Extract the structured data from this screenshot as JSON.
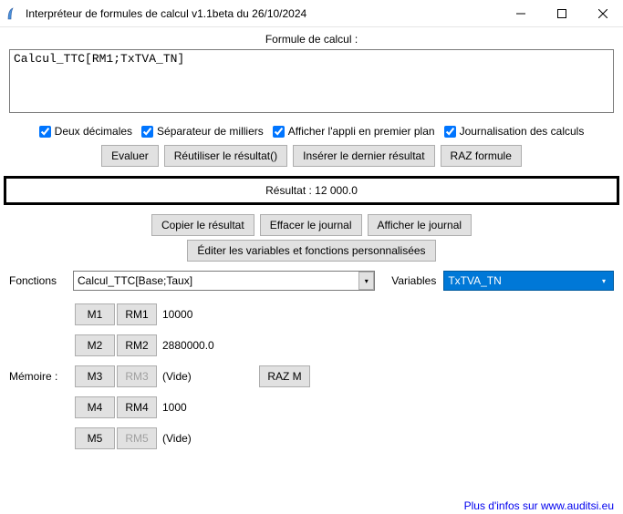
{
  "window": {
    "title": "Interpréteur de formules de calcul v1.1beta du 26/10/2024"
  },
  "labels": {
    "formula": "Formule de calcul :",
    "result_prefix": "Résultat : ",
    "fonctions": "Fonctions",
    "variables": "Variables",
    "memoire": "Mémoire :"
  },
  "formula_value": "Calcul_TTC[RM1;TxTVA_TN]",
  "checkboxes": {
    "deux_dec": "Deux décimales",
    "sep_mille": "Séparateur de milliers",
    "premier_plan": "Afficher l'appli en premier plan",
    "journal": "Journalisation des calculs"
  },
  "buttons": {
    "evaluer": "Evaluer",
    "reutiliser": "Réutiliser le résultat()",
    "inserer": "Insérer le dernier résultat",
    "raz_formule": "RAZ formule",
    "copier": "Copier le résultat",
    "effacer_journal": "Effacer le journal",
    "afficher_journal": "Afficher le journal",
    "editer_vars": "Éditer les variables et fonctions personnalisées",
    "raz_m": "RAZ M"
  },
  "result_value": "12 000.0",
  "fonctions_value": "Calcul_TTC[Base;Taux]",
  "variables_value": "TxTVA_TN",
  "memory": [
    {
      "m": "M1",
      "rm": "RM1",
      "rm_enabled": true,
      "val": "10000"
    },
    {
      "m": "M2",
      "rm": "RM2",
      "rm_enabled": true,
      "val": "2880000.0"
    },
    {
      "m": "M3",
      "rm": "RM3",
      "rm_enabled": false,
      "val": "(Vide)"
    },
    {
      "m": "M4",
      "rm": "RM4",
      "rm_enabled": true,
      "val": "1000"
    },
    {
      "m": "M5",
      "rm": "RM5",
      "rm_enabled": false,
      "val": "(Vide)"
    }
  ],
  "footer": "Plus d'infos sur www.auditsi.eu"
}
